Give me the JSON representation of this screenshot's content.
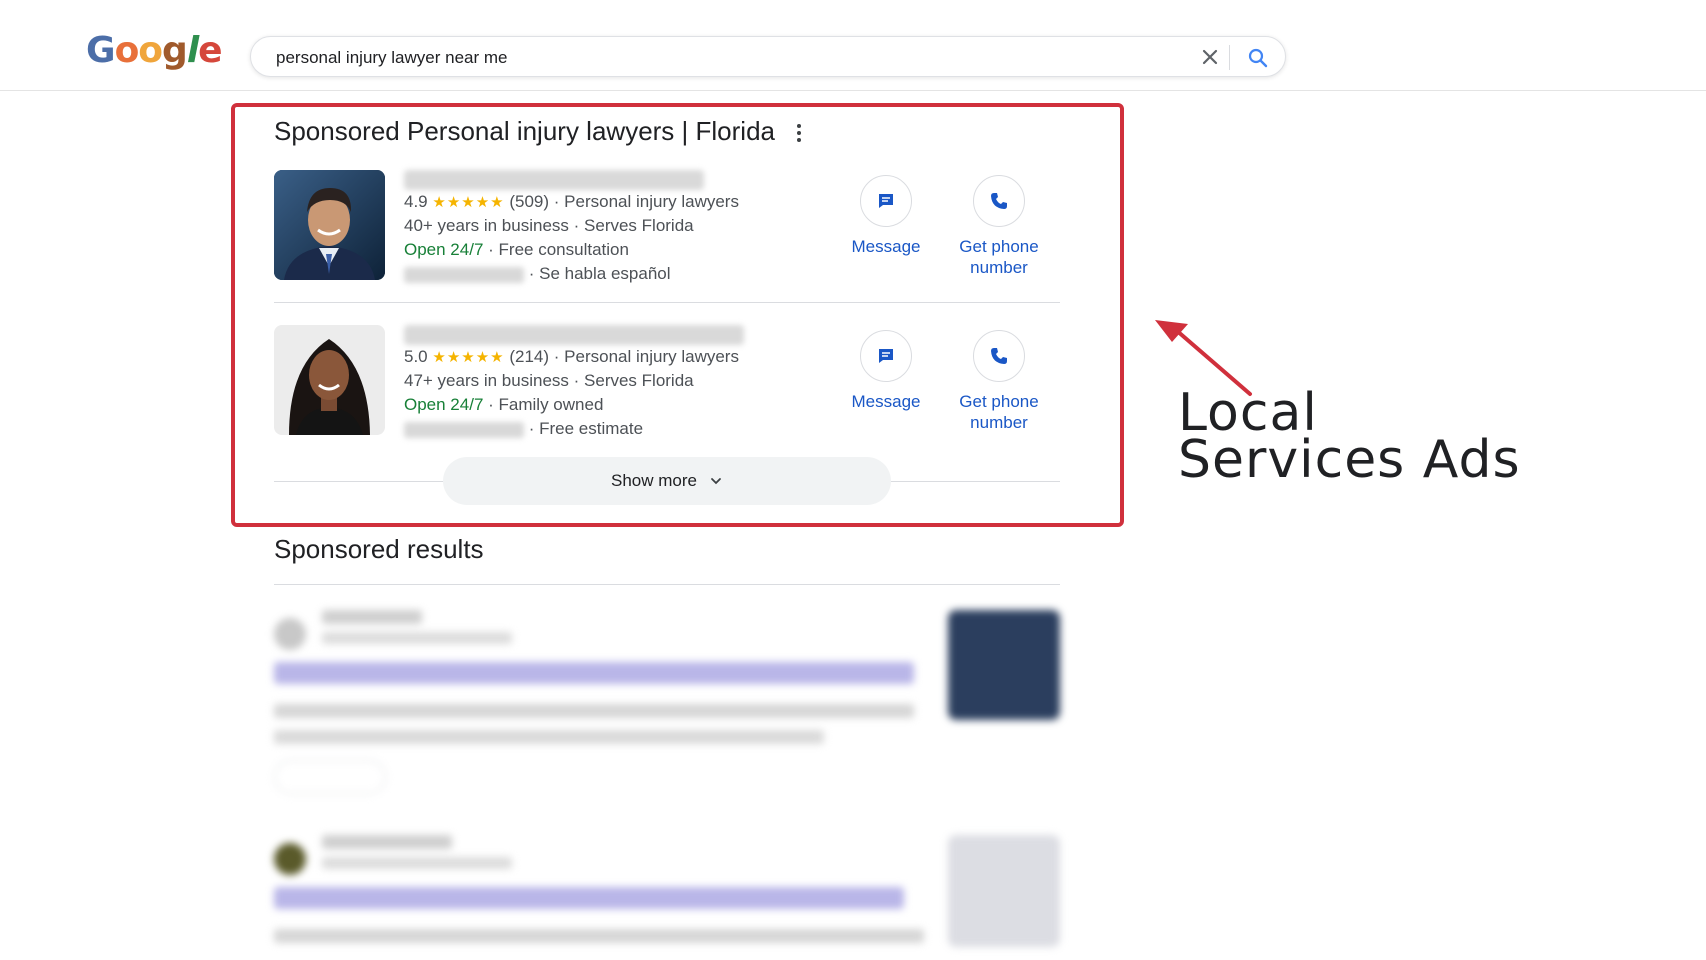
{
  "header": {
    "logo_text": [
      "G",
      "o",
      "o",
      "g",
      "l",
      "e"
    ],
    "search": {
      "query": "personal injury lawyer near me",
      "clear_icon": "close-icon",
      "search_icon": "search-icon"
    }
  },
  "lsa": {
    "title": "Sponsored Personal injury lawyers | Florida",
    "menu_icon": "more-vert-icon",
    "ads": [
      {
        "rating": "4.9",
        "stars": "★★★★★",
        "reviews": "(509)",
        "category": "· Personal injury lawyers",
        "years": "40+ years in business",
        "serves": "· Serves Florida",
        "hours": "Open 24/7",
        "feature": "· Free consultation",
        "extra": "· Se habla español",
        "message_label": "Message",
        "phone_label": "Get phone number"
      },
      {
        "rating": "5.0",
        "stars": "★★★★★",
        "reviews": "(214)",
        "category": "· Personal injury lawyers",
        "years": "47+ years in business",
        "serves": "· Serves Florida",
        "hours": "Open 24/7",
        "feature": "· Family owned",
        "extra": "· Free estimate",
        "message_label": "Message",
        "phone_label": "Get phone number"
      }
    ],
    "show_more_label": "Show more"
  },
  "annotation": {
    "line1": "Local",
    "line2": "Services Ads",
    "accent_color": "#d0303c"
  },
  "sponsored_results": {
    "title": "Sponsored results"
  }
}
